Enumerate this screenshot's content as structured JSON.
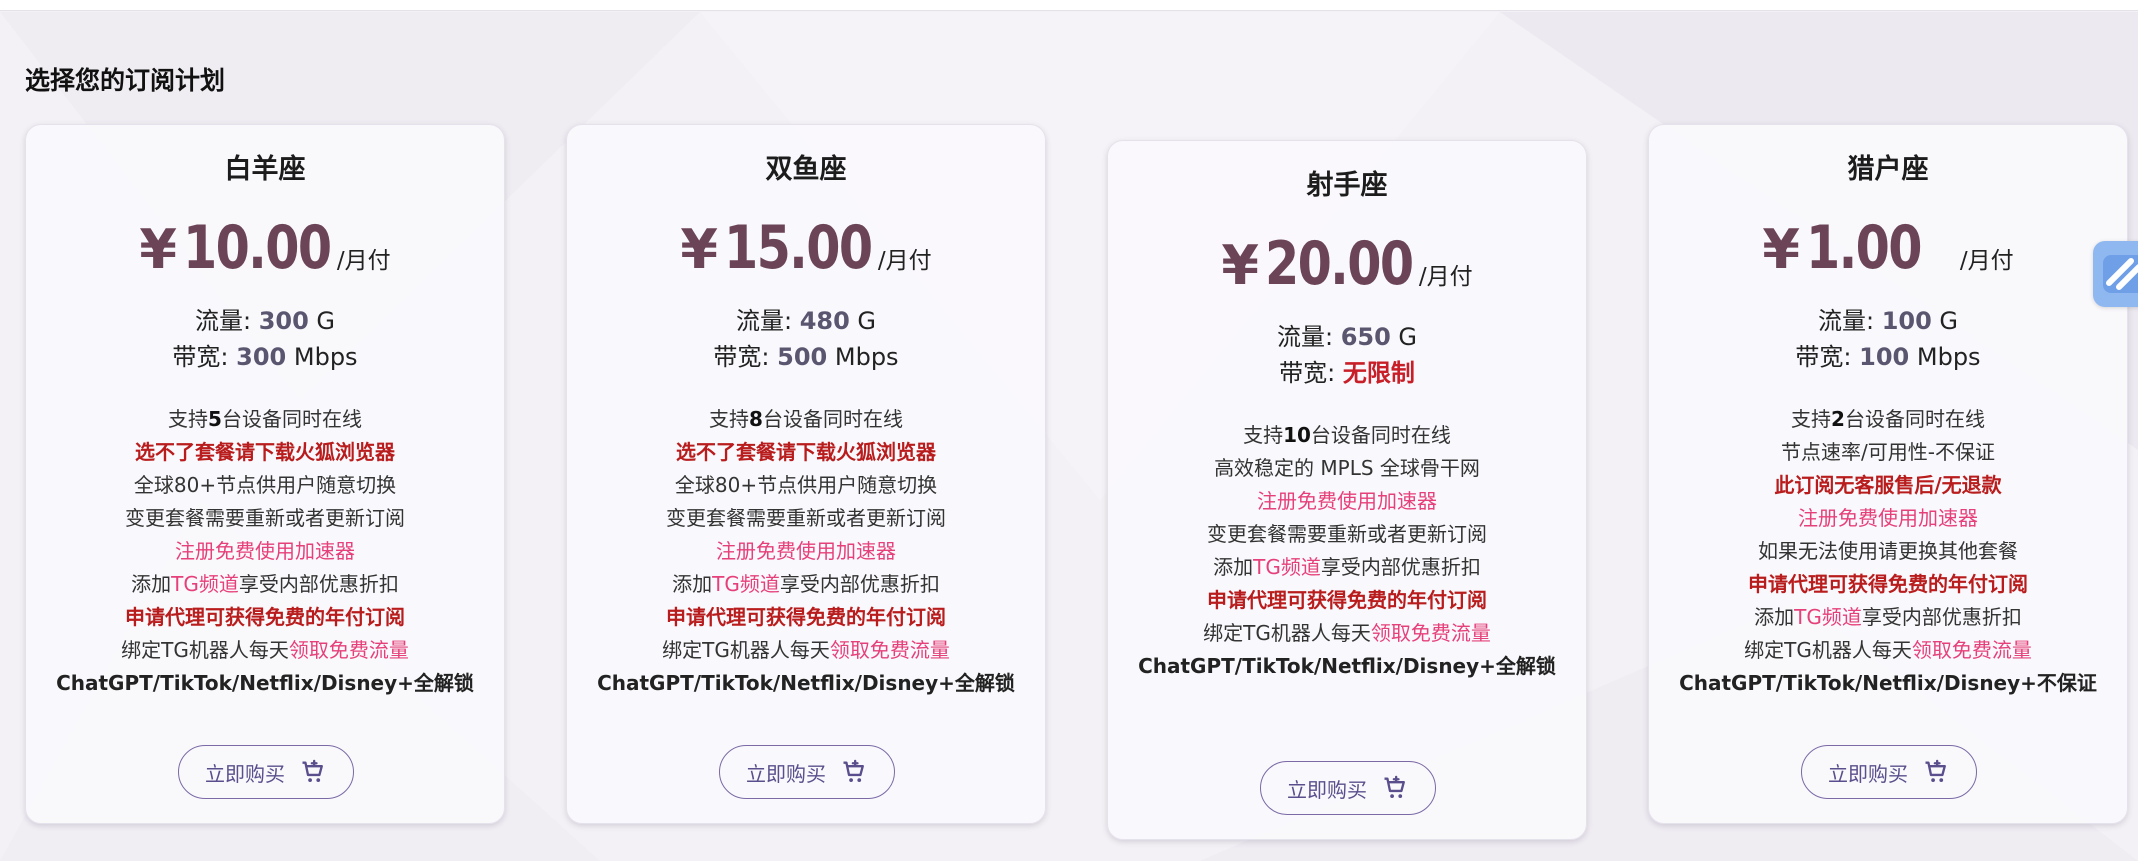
{
  "section": {
    "title": "选择您的订阅计划"
  },
  "plans": [
    {
      "name": "白羊座",
      "currency": "¥",
      "price": "10.00",
      "unit": "/月付",
      "traffic_label": "流量: ",
      "traffic_value": "300",
      "traffic_unit": " G",
      "bandwidth_label": "带宽: ",
      "bandwidth_value": "300",
      "bandwidth_unit": " Mbps",
      "features": [
        {
          "style": "device",
          "pre": "支持",
          "num": "5",
          "post": "台设备同时在线"
        },
        {
          "style": "red",
          "text": "选不了套餐请下载火狐浏览器"
        },
        {
          "style": "plain",
          "text": "全球80+节点供用户随意切换"
        },
        {
          "style": "plain",
          "text": "变更套餐需要重新或者更新订阅"
        },
        {
          "style": "pink",
          "text": "注册免费使用加速器"
        },
        {
          "style": "mixed",
          "pre": "添加",
          "hl": "TG频道",
          "post": "享受内部优惠折扣"
        },
        {
          "style": "red",
          "text": "申请代理可获得免费的年付订阅"
        },
        {
          "style": "mixed",
          "pre": "绑定TG机器人每天",
          "hl": "领取免费流量",
          "post": ""
        },
        {
          "style": "bold",
          "text": "ChatGPT/TikTok/Netflix/Disney+全解锁"
        }
      ],
      "buy_label": "立即购买"
    },
    {
      "name": "双鱼座",
      "currency": "¥",
      "price": "15.00",
      "unit": "/月付",
      "traffic_label": "流量: ",
      "traffic_value": "480",
      "traffic_unit": " G",
      "bandwidth_label": "带宽: ",
      "bandwidth_value": "500",
      "bandwidth_unit": " Mbps",
      "features": [
        {
          "style": "device",
          "pre": "支持",
          "num": "8",
          "post": "台设备同时在线"
        },
        {
          "style": "red",
          "text": "选不了套餐请下载火狐浏览器"
        },
        {
          "style": "plain",
          "text": "全球80+节点供用户随意切换"
        },
        {
          "style": "plain",
          "text": "变更套餐需要重新或者更新订阅"
        },
        {
          "style": "pink",
          "text": "注册免费使用加速器"
        },
        {
          "style": "mixed",
          "pre": "添加",
          "hl": "TG频道",
          "post": "享受内部优惠折扣"
        },
        {
          "style": "red",
          "text": "申请代理可获得免费的年付订阅"
        },
        {
          "style": "mixed",
          "pre": "绑定TG机器人每天",
          "hl": "领取免费流量",
          "post": ""
        },
        {
          "style": "bold",
          "text": "ChatGPT/TikTok/Netflix/Disney+全解锁"
        }
      ],
      "buy_label": "立即购买"
    },
    {
      "name": "射手座",
      "currency": "¥",
      "price": "20.00",
      "unit": "/月付",
      "traffic_label": "流量: ",
      "traffic_value": "650",
      "traffic_unit": " G",
      "bandwidth_label": "带宽: ",
      "bandwidth_value": "无限制",
      "bandwidth_unit": "",
      "features": [
        {
          "style": "device",
          "pre": "支持",
          "num": "10",
          "post": "台设备同时在线"
        },
        {
          "style": "plain",
          "text": "高效稳定的 MPLS 全球骨干网"
        },
        {
          "style": "pink",
          "text": "注册免费使用加速器"
        },
        {
          "style": "plain",
          "text": "变更套餐需要重新或者更新订阅"
        },
        {
          "style": "mixed",
          "pre": "添加",
          "hl": "TG频道",
          "post": "享受内部优惠折扣"
        },
        {
          "style": "red",
          "text": "申请代理可获得免费的年付订阅"
        },
        {
          "style": "mixed",
          "pre": "绑定TG机器人每天",
          "hl": "领取免费流量",
          "post": ""
        },
        {
          "style": "bold",
          "text": "ChatGPT/TikTok/Netflix/Disney+全解锁"
        }
      ],
      "buy_label": "立即购买"
    },
    {
      "name": "猎户座",
      "currency": "¥",
      "price": "1.00",
      "unit": "/月付",
      "traffic_label": "流量: ",
      "traffic_value": "100",
      "traffic_unit": " G",
      "bandwidth_label": "带宽: ",
      "bandwidth_value": "100",
      "bandwidth_unit": " Mbps",
      "features": [
        {
          "style": "device",
          "pre": "支持",
          "num": "2",
          "post": "台设备同时在线"
        },
        {
          "style": "plain",
          "text": "节点速率/可用性-不保证"
        },
        {
          "style": "red",
          "text": "此订阅无客服售后/无退款"
        },
        {
          "style": "pink",
          "text": "注册免费使用加速器"
        },
        {
          "style": "plain",
          "text": "如果无法使用请更换其他套餐"
        },
        {
          "style": "red",
          "text": "申请代理可获得免费的年付订阅"
        },
        {
          "style": "mixed",
          "pre": "添加",
          "hl": "TG频道",
          "post": "享受内部优惠折扣"
        },
        {
          "style": "mixed",
          "pre": "绑定TG机器人每天",
          "hl": "领取免费流量",
          "post": ""
        },
        {
          "style": "bold",
          "text": "ChatGPT/TikTok/Netflix/Disney+不保证"
        }
      ],
      "buy_label": "立即购买"
    }
  ],
  "icons": {
    "cart": "cart-icon",
    "float": "float-widget-icon"
  },
  "colors": {
    "price": "#6b4557",
    "accent_red": "#c81e28",
    "accent_pink": "#e6407a",
    "button": "#5a4f8c"
  }
}
